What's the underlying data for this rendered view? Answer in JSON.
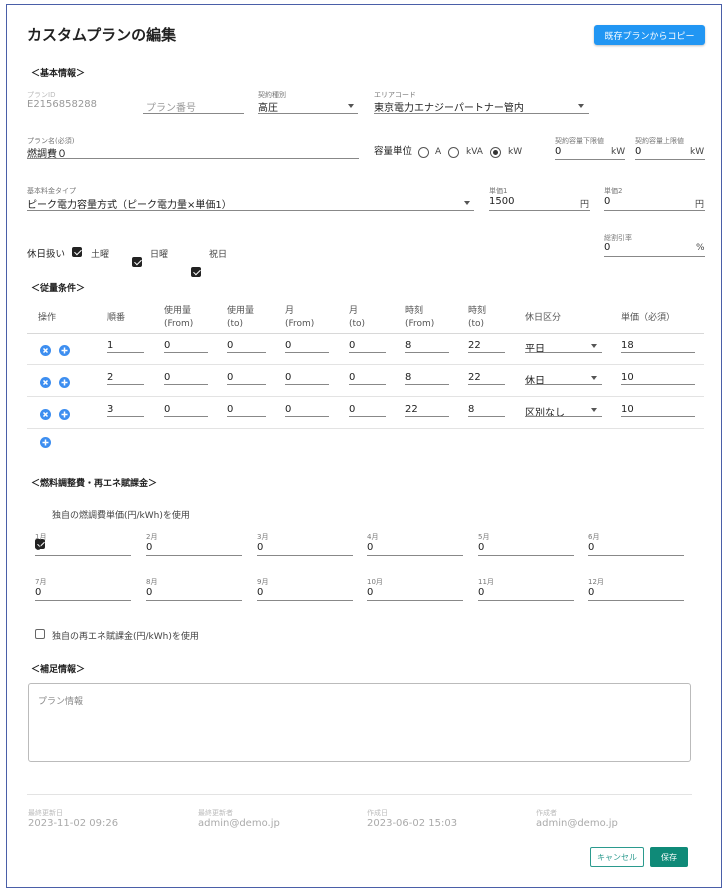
{
  "page": {
    "title": "カスタムプランの編集",
    "copy_button": "既存プランからコピー"
  },
  "sections": {
    "basic": "＜基本情報＞",
    "conditions": "＜従量条件＞",
    "fuel": "＜燃料調整費・再エネ賦課金＞",
    "supplement": "＜補足情報＞"
  },
  "basic": {
    "plan_id_label": "プランID",
    "plan_id_value": "E2156858288",
    "plan_no_placeholder": "プラン番号",
    "contract_type_label": "契約種別",
    "contract_type_value": "高圧",
    "area_code_label": "エリアコード",
    "area_code_value": "東京電力エナジーパートナー管内",
    "plan_name_label": "プラン名(必須)",
    "plan_name_value": "燃調費０",
    "capacity_unit_label": "容量単位",
    "capacity_options": [
      "A",
      "kVA",
      "kW"
    ],
    "capacity_selected": "kW",
    "min_cap_label": "契約容量下限値",
    "min_cap_value": "0",
    "min_cap_unit": "kW",
    "max_cap_label": "契約容量上限値",
    "max_cap_value": "0",
    "max_cap_unit": "kW",
    "base_type_label": "基本料金タイプ",
    "base_type_value": "ピーク電力容量方式（ピーク電力量×単価1）",
    "price1_label": "単価1",
    "price1_value": "1500",
    "price1_unit": "円",
    "price2_label": "単価2",
    "price2_value": "0",
    "price2_unit": "円",
    "discount_label": "総割引率",
    "discount_value": "0",
    "discount_unit": "%",
    "holiday_label": "休日扱い",
    "holidays": [
      {
        "label": "土曜",
        "checked": true
      },
      {
        "label": "日曜",
        "checked": true
      },
      {
        "label": "祝日",
        "checked": true
      }
    ]
  },
  "conditions": {
    "headers": [
      [
        "操作"
      ],
      [
        "順番"
      ],
      [
        "使用量",
        "(From)"
      ],
      [
        "使用量",
        "(to)"
      ],
      [
        "月",
        "(From)"
      ],
      [
        "月",
        "(to)"
      ],
      [
        "時刻",
        "(From)"
      ],
      [
        "時刻",
        "(to)"
      ],
      [
        "休日区分"
      ],
      [
        "単価（必須）"
      ]
    ],
    "rows": [
      {
        "order": "1",
        "use_from": "0",
        "use_to": "0",
        "month_from": "0",
        "month_to": "0",
        "time_from": "8",
        "time_to": "22",
        "holiday": "平日",
        "price": "18"
      },
      {
        "order": "2",
        "use_from": "0",
        "use_to": "0",
        "month_from": "0",
        "month_to": "0",
        "time_from": "8",
        "time_to": "22",
        "holiday": "休日",
        "price": "10"
      },
      {
        "order": "3",
        "use_from": "0",
        "use_to": "0",
        "month_from": "0",
        "month_to": "0",
        "time_from": "22",
        "time_to": "8",
        "holiday": "区別なし",
        "price": "10"
      }
    ]
  },
  "fuel": {
    "own_fuel_label": "独自の燃調費単価(円/kWh)を使用",
    "own_fuel_checked": true,
    "months": [
      {
        "label": "1月",
        "value": "0"
      },
      {
        "label": "2月",
        "value": "0"
      },
      {
        "label": "3月",
        "value": "0"
      },
      {
        "label": "4月",
        "value": "0"
      },
      {
        "label": "5月",
        "value": "0"
      },
      {
        "label": "6月",
        "value": "0"
      },
      {
        "label": "7月",
        "value": "0"
      },
      {
        "label": "8月",
        "value": "0"
      },
      {
        "label": "9月",
        "value": "0"
      },
      {
        "label": "10月",
        "value": "0"
      },
      {
        "label": "11月",
        "value": "0"
      },
      {
        "label": "12月",
        "value": "0"
      }
    ],
    "own_renew_label": "独自の再エネ賦課金(円/kWh)を使用",
    "own_renew_checked": false
  },
  "supplement": {
    "placeholder": "プラン情報"
  },
  "meta": {
    "updated_at_label": "最終更新日",
    "updated_at": "2023-11-02 09:26",
    "updated_by_label": "最終更新者",
    "updated_by": "admin@demo.jp",
    "created_at_label": "作成日",
    "created_at": "2023-06-02 15:03",
    "created_by_label": "作成者",
    "created_by": "admin@demo.jp"
  },
  "buttons": {
    "cancel": "キャンセル",
    "save": "保存"
  },
  "colors": {
    "primary": "#2196f3",
    "save": "#0f8a78",
    "cancel_border": "#2b9a8e",
    "row_icon": "#3d8ef0"
  }
}
